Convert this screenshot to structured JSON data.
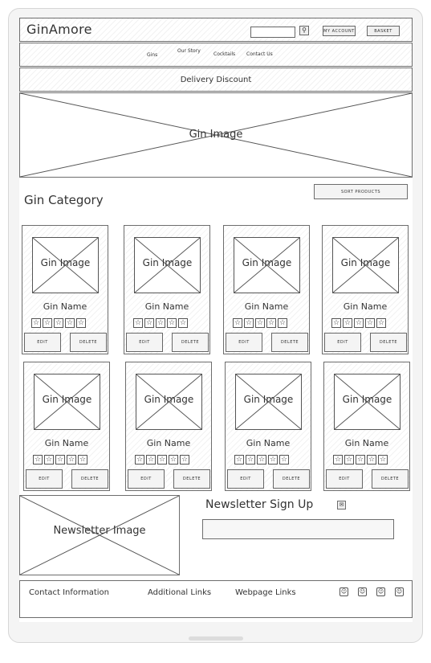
{
  "header": {
    "logo": "GinAmore",
    "search_placeholder": "",
    "search_icon": "magnifier-icon",
    "account_label": "MY ACCOUNT",
    "basket_label": "BASKET"
  },
  "nav": {
    "items": [
      "Gins",
      "Our Story",
      "Cocktails",
      "Contact Us"
    ]
  },
  "banner": {
    "delivery": "Delivery Discount",
    "hero_image_label": "Gin Image"
  },
  "category": {
    "title": "Gin Category",
    "sort_label": "SORT PRODUCTS"
  },
  "products": [
    {
      "image_label": "Gin Image",
      "name": "Gin Name",
      "stars": 5,
      "edit": "EDIT",
      "delete": "DELETE"
    },
    {
      "image_label": "Gin Image",
      "name": "Gin Name",
      "stars": 5,
      "edit": "EDIT",
      "delete": "DELETE"
    },
    {
      "image_label": "Gin Image",
      "name": "Gin Name",
      "stars": 5,
      "edit": "EDIT",
      "delete": "DELETE"
    },
    {
      "image_label": "Gin Image",
      "name": "Gin Name",
      "stars": 5,
      "edit": "EDIT",
      "delete": "DELETE"
    },
    {
      "image_label": "Gin Image",
      "name": "Gin Name",
      "stars": 5,
      "edit": "EDIT",
      "delete": "DELETE"
    },
    {
      "image_label": "Gin Image",
      "name": "Gin Name",
      "stars": 5,
      "edit": "EDIT",
      "delete": "DELETE"
    },
    {
      "image_label": "Gin Image",
      "name": "Gin Name",
      "stars": 5,
      "edit": "EDIT",
      "delete": "DELETE"
    },
    {
      "image_label": "Gin Image",
      "name": "Gin Name",
      "stars": 5,
      "edit": "EDIT",
      "delete": "DELETE"
    }
  ],
  "newsletter": {
    "image_label": "Newsletter Image",
    "title": "Newsletter Sign Up",
    "submit_icon": "submit-icon",
    "input_placeholder": ""
  },
  "footer": {
    "contact": "Contact Information",
    "additional": "Additional Links",
    "webpage": "Webpage Links",
    "social_icons": [
      "social-icon",
      "social-icon",
      "social-icon",
      "social-icon"
    ]
  }
}
